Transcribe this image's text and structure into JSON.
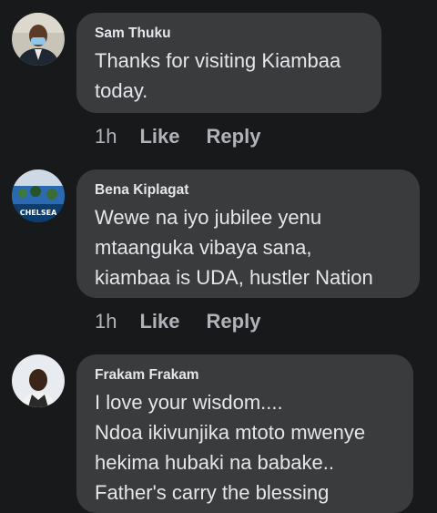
{
  "comments": [
    {
      "author": "Sam Thuku",
      "lines": [
        "Thanks for visiting Kiambaa",
        "today."
      ],
      "time": "1h",
      "like_label": "Like",
      "reply_label": "Reply"
    },
    {
      "author": "Bena Kiplagat",
      "lines": [
        "Wewe na iyo jubilee yenu",
        "mtaanguka vibaya sana,",
        "kiambaa is UDA, hustler Nation"
      ],
      "time": "1h",
      "like_label": "Like",
      "reply_label": "Reply",
      "avatar_text": "CHELSEA"
    },
    {
      "author": "Frakam Frakam",
      "lines": [
        "I love your wisdom....",
        "Ndoa ikivunjika mtoto mwenye",
        "hekima hubaki na babake..",
        "Father's carry the blessing"
      ]
    }
  ],
  "colors": {
    "background": "#18191a",
    "bubble": "#3a3b3c",
    "text": "#e4e6eb",
    "muted": "#b0b3b8"
  }
}
